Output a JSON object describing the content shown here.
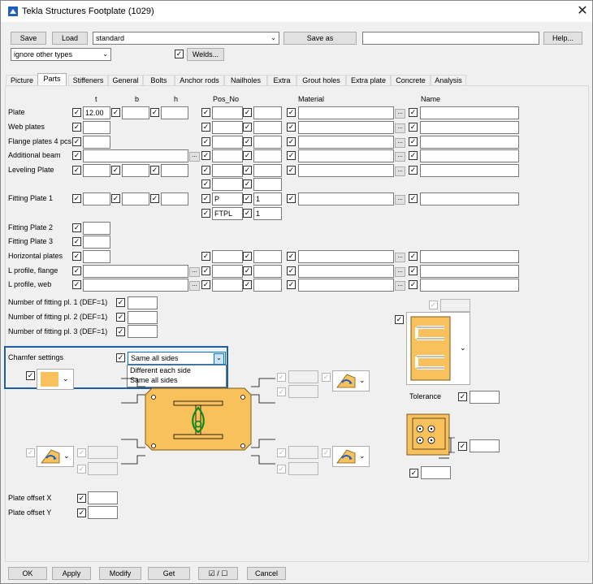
{
  "window": {
    "title": "Tekla Structures  Footplate (1029)",
    "close_glyph": "✕"
  },
  "toolbar": {
    "save_label": "Save",
    "load_label": "Load",
    "preset_value": "standard",
    "saveas_label": "Save as",
    "saveas_value": "",
    "help_label": "Help...",
    "ignore_value": "ignore other types",
    "welds_label": "Welds..."
  },
  "tabs": [
    "Picture",
    "Parts",
    "Stiffeners",
    "General",
    "Bolts",
    "Anchor rods",
    "Nailholes",
    "Extra",
    "Grout holes",
    "Extra plate",
    "Concrete",
    "Analysis"
  ],
  "active_tab": "Parts",
  "headers": {
    "t": "t",
    "b": "b",
    "h": "h",
    "pos_no": "Pos_No",
    "material": "Material",
    "name": "Name"
  },
  "rows": {
    "plate": "Plate",
    "plate_t": "12.00",
    "web_plates": "Web plates",
    "flange_plates": "Flange plates 4 pcs",
    "additional_beam": "Additional beam",
    "leveling_plate": "Leveling Plate",
    "fitting_plate_1": "Fitting Plate 1",
    "fp1_pos_prefix": "P",
    "fp1_pos_start": "1",
    "fp1_pos2_prefix": "FTPL",
    "fp1_pos2_start": "1",
    "fitting_plate_2": "Fitting Plate 2",
    "fitting_plate_3": "Fitting Plate 3",
    "horizontal_plates": "Horizontal plates",
    "l_profile_flange": "L profile, flange",
    "l_profile_web": "L profile, web",
    "num_fp1": "Number of fitting pl. 1 (DEF=1)",
    "num_fp2": "Number of fitting pl. 2 (DEF=1)",
    "num_fp3": "Number of fitting pl. 3 (DEF=1)"
  },
  "chamfer": {
    "label": "Chamfer settings",
    "value": "Same all sides",
    "options": [
      "Different each side",
      "Same all sides"
    ]
  },
  "tolerance_label": "Tolerance",
  "offsets": {
    "x": "Plate offset X",
    "y": "Plate offset Y"
  },
  "bottom": {
    "ok": "OK",
    "apply": "Apply",
    "modify": "Modify",
    "get": "Get",
    "toggle": "☑ / ☐",
    "cancel": "Cancel"
  },
  "colors": {
    "plate_fill": "#f8c15c",
    "accent": "#1f5ea3",
    "anchor_green": "#0f8a1f",
    "sym_blue": "#1e5fbf"
  },
  "checkmark": "✓",
  "ellipsis": "...",
  "arrow_down": "⌄"
}
